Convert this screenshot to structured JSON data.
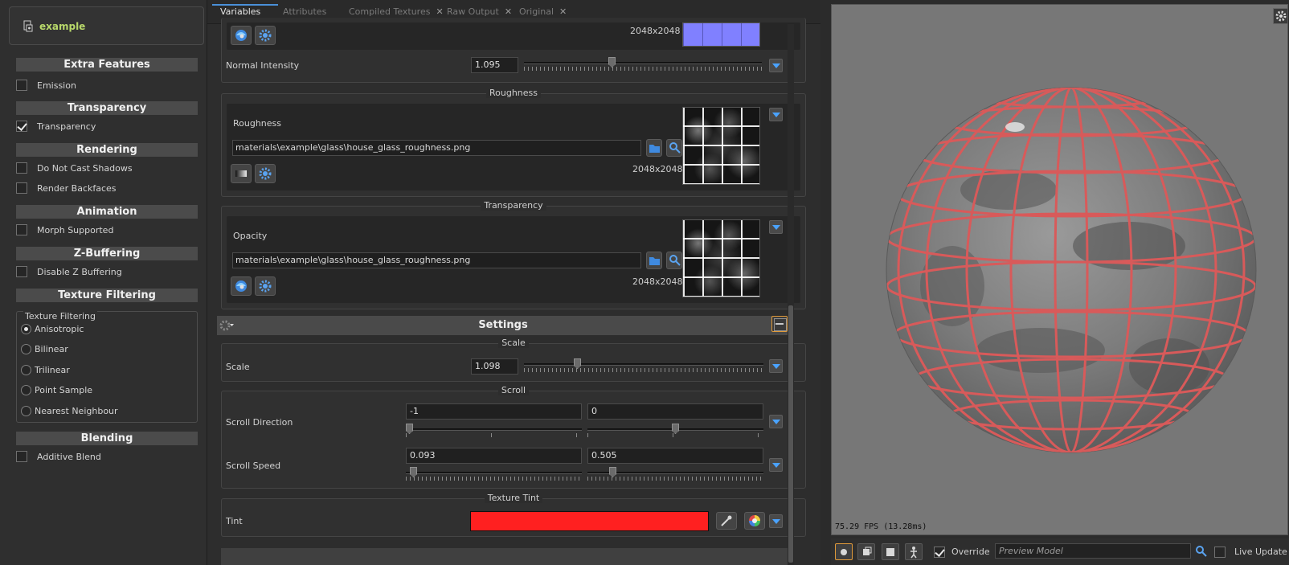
{
  "material": {
    "name": "example"
  },
  "left": {
    "sections": {
      "extra": {
        "title": "Extra Features",
        "items": [
          {
            "label": "Emission",
            "checked": false
          }
        ]
      },
      "transparency": {
        "title": "Transparency",
        "items": [
          {
            "label": "Transparency",
            "checked": true
          }
        ]
      },
      "rendering": {
        "title": "Rendering",
        "items": [
          {
            "label": "Do Not Cast Shadows",
            "checked": false
          },
          {
            "label": "Render Backfaces",
            "checked": false
          }
        ]
      },
      "animation": {
        "title": "Animation",
        "items": [
          {
            "label": "Morph Supported",
            "checked": false
          }
        ]
      },
      "zbuffer": {
        "title": "Z-Buffering",
        "items": [
          {
            "label": "Disable Z Buffering",
            "checked": false
          }
        ]
      },
      "texfilter": {
        "title": "Texture Filtering",
        "group_label": "Texture Filtering",
        "options": [
          "Anisotropic",
          "Bilinear",
          "Trilinear",
          "Point Sample",
          "Nearest Neighbour"
        ],
        "selected": "Anisotropic"
      },
      "blending": {
        "title": "Blending",
        "items": [
          {
            "label": "Additive Blend",
            "checked": false
          }
        ]
      }
    }
  },
  "tabs": [
    {
      "label": "Variables",
      "active": true,
      "closable": false
    },
    {
      "label": "Attributes",
      "active": false,
      "closable": false
    },
    {
      "label": "Compiled Textures",
      "active": false,
      "closable": true
    },
    {
      "label": "Raw Output",
      "active": false,
      "closable": true
    },
    {
      "label": "Original",
      "active": false,
      "closable": true
    }
  ],
  "normal": {
    "resolution": "2048x2048",
    "intensity_label": "Normal Intensity",
    "intensity_value": "1.095",
    "swatch_color": "#8080ff"
  },
  "roughness": {
    "group_title": "Roughness",
    "label": "Roughness",
    "path": "materials\\example\\glass\\house_glass_roughness.png",
    "resolution": "2048x2048"
  },
  "transparency": {
    "group_title": "Transparency",
    "label": "Opacity",
    "path": "materials\\example\\glass\\house_glass_roughness.png",
    "resolution": "2048x2048"
  },
  "settings": {
    "title": "Settings",
    "scale": {
      "group_title": "Scale",
      "label": "Scale",
      "value": "1.098"
    },
    "scroll": {
      "group_title": "Scroll",
      "direction_label": "Scroll Direction",
      "direction_x": "-1",
      "direction_y": "0",
      "speed_label": "Scroll Speed",
      "speed_x": "0.093",
      "speed_y": "0.505"
    },
    "tint": {
      "group_title": "Texture Tint",
      "label": "Tint",
      "color": "#ff2020"
    }
  },
  "viewport": {
    "fps": "75.29 FPS (13.28ms)",
    "override_label": "Override",
    "override_checked": true,
    "preview_placeholder": "Preview Model",
    "live_update_label": "Live Update",
    "live_update_checked": false,
    "sphere_line_color": "#d85a5a"
  }
}
